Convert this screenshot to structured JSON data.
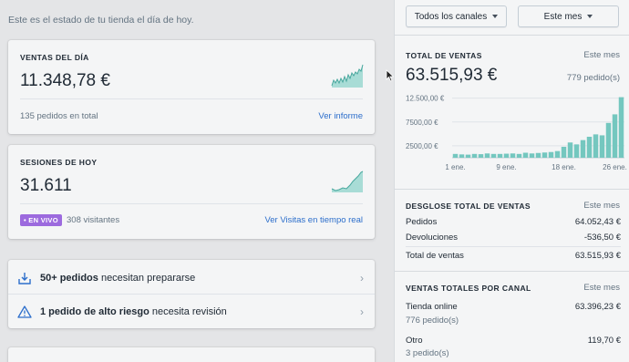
{
  "intro_text": "Este es el estado de tu tienda el día de hoy.",
  "sales_card": {
    "label": "VENTAS DEL DÍA",
    "value": "11.348,78 €",
    "orders_text": "135 pedidos en total",
    "link": "Ver informe"
  },
  "sessions_card": {
    "label": "SESIONES DE HOY",
    "value": "31.611",
    "live_badge": "• EN VIVO",
    "visitors": "308 visitantes",
    "link": "Ver Visitas en tiempo real"
  },
  "tasks": [
    {
      "bold": "50+ pedidos",
      "rest": " necesitan prepararse",
      "icon": "download-box-icon"
    },
    {
      "bold": "1 pedido de alto riesgo",
      "rest": " necesita revisión",
      "icon": "warning-triangle-icon"
    }
  ],
  "filters": {
    "channel": "Todos los canales",
    "period": "Este mes"
  },
  "total_sales": {
    "label": "TOTAL DE VENTAS",
    "period": "Este mes",
    "value": "63.515,93 €",
    "orders": "779 pedido(s)"
  },
  "breakdown": {
    "label": "DESGLOSE TOTAL DE VENTAS",
    "period": "Este mes",
    "rows": [
      {
        "name": "Pedidos",
        "value": "64.052,43 €"
      },
      {
        "name": "Devoluciones",
        "value": "-536,50 €"
      },
      {
        "name": "Total de ventas",
        "value": "63.515,93 €"
      }
    ]
  },
  "by_channel": {
    "label": "VENTAS TOTALES POR CANAL",
    "period": "Este mes",
    "rows": [
      {
        "name": "Tienda online",
        "value": "63.396,23 €",
        "sub": "776 pedido(s)"
      },
      {
        "name": "Otro",
        "value": "119,70 €",
        "sub": "3 pedido(s)"
      }
    ]
  },
  "colors": {
    "accent": "#2c6ecb",
    "chart_fill": "#74c7bf",
    "chart_line": "#47a79d",
    "badge": "#9c6ade"
  },
  "chart_data": {
    "type": "bar",
    "title": "",
    "categories": [
      "1 ene.",
      "2 ene.",
      "3 ene.",
      "4 ene.",
      "5 ene.",
      "6 ene.",
      "7 ene.",
      "8 ene.",
      "9 ene.",
      "10 ene.",
      "11 ene.",
      "12 ene.",
      "13 ene.",
      "14 ene.",
      "15 ene.",
      "16 ene.",
      "17 ene.",
      "18 ene.",
      "19 ene.",
      "20 ene.",
      "21 ene.",
      "22 ene.",
      "23 ene.",
      "24 ene.",
      "25 ene.",
      "26 ene.",
      "27 ene."
    ],
    "x_tick_labels": [
      "1 ene.",
      "9 ene.",
      "18 ene.",
      "26 ene."
    ],
    "y_tick_labels": [
      "12.500,00 €",
      "7500,00 €",
      "2500,00 €"
    ],
    "y_ticks": [
      12500,
      7500,
      2500
    ],
    "values": [
      800,
      700,
      650,
      800,
      750,
      900,
      800,
      800,
      850,
      900,
      800,
      1050,
      900,
      1000,
      1100,
      1200,
      1400,
      2300,
      3200,
      2800,
      3700,
      4400,
      4900,
      4700,
      7300,
      9100,
      12700
    ],
    "ylim": [
      0,
      13000
    ],
    "grid": true
  }
}
